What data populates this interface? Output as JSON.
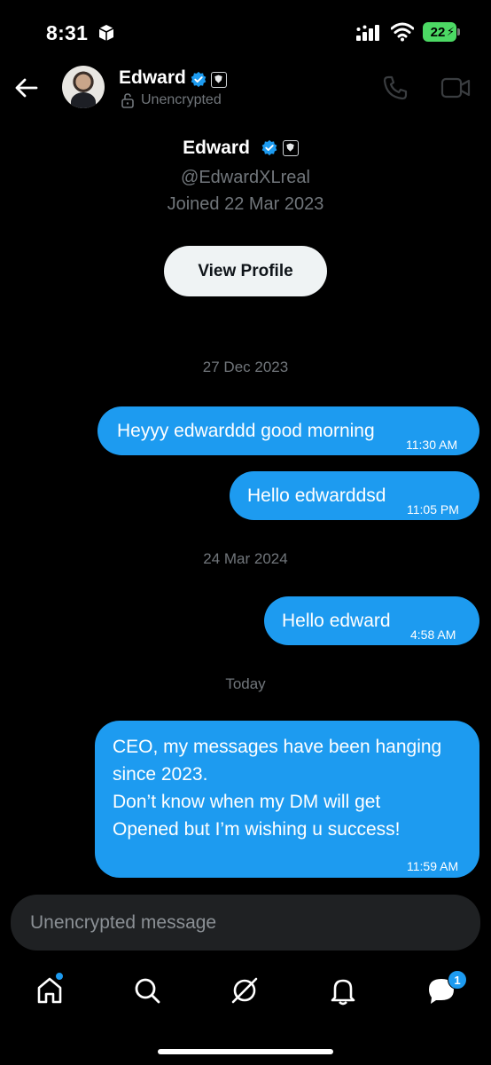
{
  "status_bar": {
    "time": "8:31",
    "battery": "22"
  },
  "header": {
    "name": "Edward",
    "encryption": "Unencrypted"
  },
  "profile": {
    "name": "Edward",
    "handle": "@EdwardXLreal",
    "joined": "Joined 22 Mar 2023",
    "view_profile_label": "View Profile"
  },
  "dates": [
    "27 Dec 2023",
    "24 Mar 2024",
    "Today"
  ],
  "messages": [
    {
      "text": "Heyyy edwarddd good morning",
      "time": "11:30 AM"
    },
    {
      "text": "Hello edwarddsd",
      "time": "11:05 PM"
    },
    {
      "text": "Hello edward",
      "time": "4:58 AM"
    },
    {
      "lines": [
        "CEO, my messages have been hanging",
        "since 2023.",
        "Don’t know when my DM will get",
        "Opened but I’m wishing u success!"
      ],
      "time": "11:59 AM"
    }
  ],
  "composer": {
    "placeholder": "Unencrypted message"
  },
  "nav": {
    "messages_badge": "1"
  },
  "colors": {
    "accent": "#1d9bf0",
    "background": "#000000",
    "muted": "#71767b"
  },
  "icons": [
    "back-arrow-icon",
    "verified-icon",
    "org-badge-icon",
    "lock-icon",
    "phone-icon",
    "video-icon",
    "home-icon",
    "search-icon",
    "grok-icon",
    "notifications-icon",
    "messages-icon"
  ]
}
